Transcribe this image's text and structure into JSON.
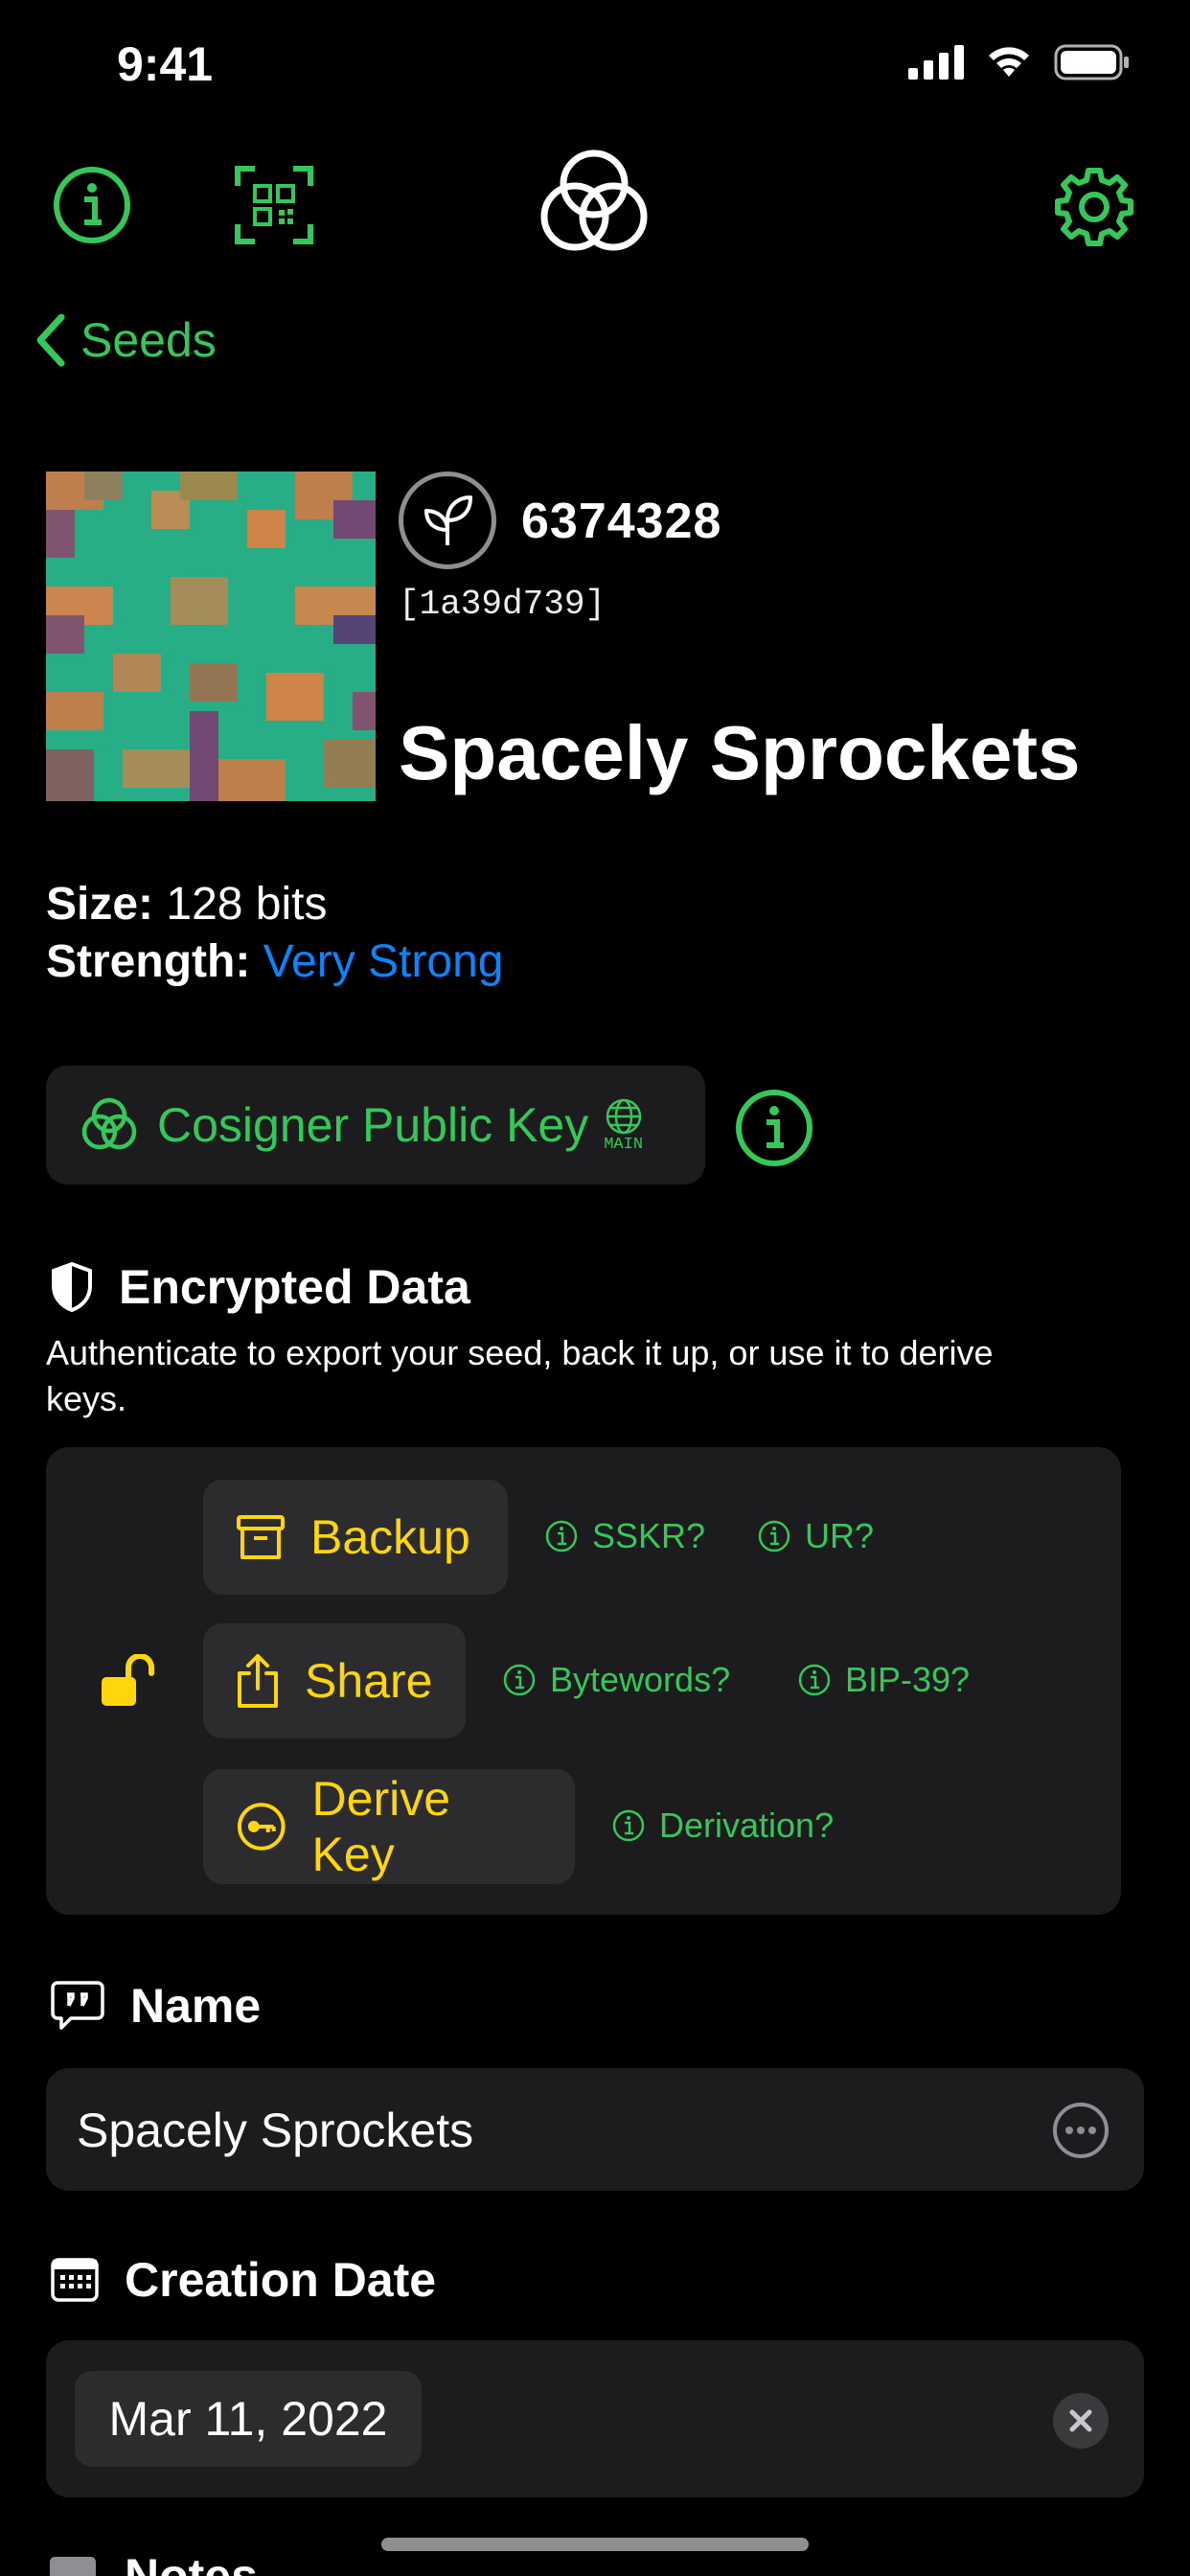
{
  "status_bar": {
    "time": "9:41"
  },
  "nav": {
    "back_label": "Seeds"
  },
  "seed": {
    "number": "6374328",
    "fingerprint": "[1a39d739]",
    "name": "Spacely Sprockets",
    "size_label": "Size:",
    "size_value": "128 bits",
    "strength_label": "Strength:",
    "strength_value": "Very Strong"
  },
  "cosigner": {
    "label": "Cosigner Public Key",
    "network_badge": "MAIN"
  },
  "encrypted": {
    "title": "Encrypted Data",
    "description": "Authenticate to export your seed, back it up, or use it to derive keys.",
    "backup_label": "Backup",
    "share_label": "Share",
    "derive_label": "Derive Key",
    "info_sskr": "SSKR?",
    "info_ur": "UR?",
    "info_bytewords": "Bytewords?",
    "info_bip39": "BIP-39?",
    "info_derivation": "Derivation?"
  },
  "name_section": {
    "title": "Name",
    "value": "Spacely Sprockets"
  },
  "date_section": {
    "title": "Creation Date",
    "value": "Mar 11, 2022"
  },
  "notes_section": {
    "title": "Notes"
  },
  "colors": {
    "accent_green": "#34c759",
    "yellow": "#ffd60a",
    "blue": "#0a84ff",
    "card": "#1c1c1e"
  }
}
